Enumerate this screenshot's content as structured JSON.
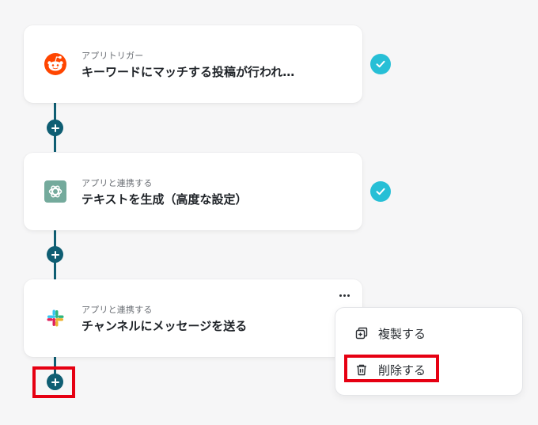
{
  "steps": [
    {
      "subtitle": "アプリトリガー",
      "title": "キーワードにマッチする投稿が行われ…",
      "icon": "reddit-icon",
      "completed": true
    },
    {
      "subtitle": "アプリと連携する",
      "title": "テキストを生成（高度な設定）",
      "icon": "openai-icon",
      "completed": true
    },
    {
      "subtitle": "アプリと連携する",
      "title": "チャンネルにメッセージを送る",
      "icon": "slack-icon",
      "completed": false
    }
  ],
  "context_menu": {
    "duplicate_label": "複製する",
    "delete_label": "削除する"
  },
  "colors": {
    "connector": "#0f5e73",
    "check": "#27bfd6",
    "highlight": "#e60012",
    "reddit": "#ff4500"
  }
}
